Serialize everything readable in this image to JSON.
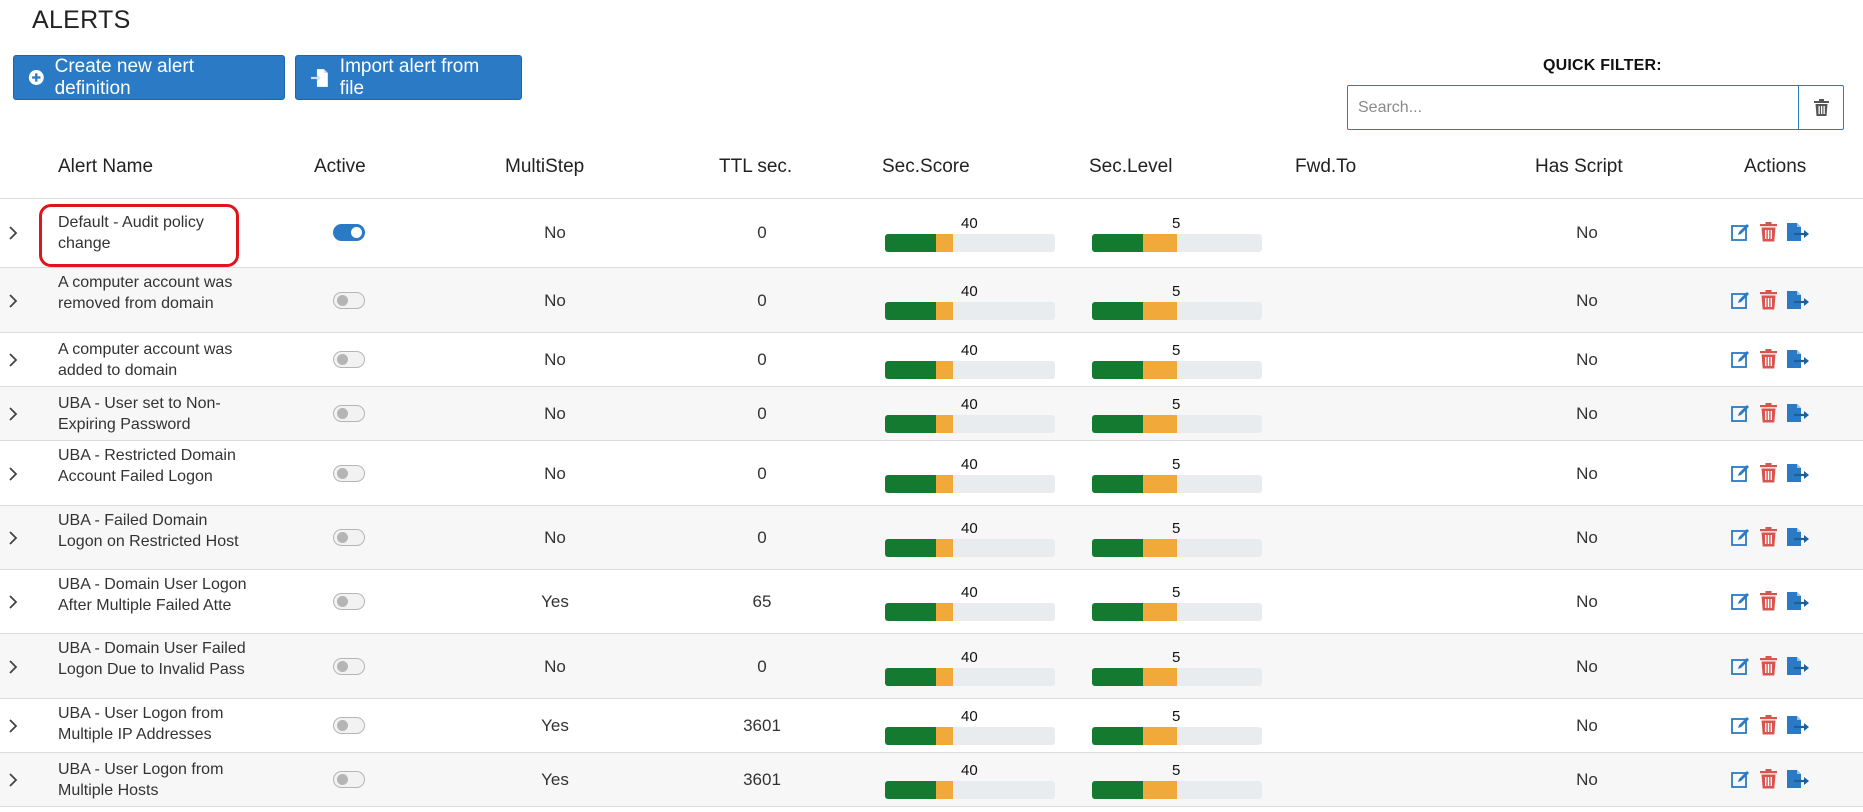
{
  "page": {
    "title": "ALERTS"
  },
  "toolbar": {
    "create_label": "Create new alert definition",
    "import_label": "Import alert from file"
  },
  "quick_filter": {
    "label": "QUICK FILTER:",
    "placeholder": "Search...",
    "value": ""
  },
  "columns": [
    "Alert Name",
    "Active",
    "MultiStep",
    "TTL sec.",
    "Sec.Score",
    "Sec.Level",
    "Fwd.To",
    "Has Script",
    "Actions"
  ],
  "rows": [
    {
      "name": "Default - Audit policy change",
      "active": true,
      "multistep": "No",
      "ttl": "0",
      "sec_score": "40",
      "sec_level": "5",
      "fwd_to": "",
      "has_script": "No"
    },
    {
      "name": "A computer account was removed from domain",
      "active": false,
      "multistep": "No",
      "ttl": "0",
      "sec_score": "40",
      "sec_level": "5",
      "fwd_to": "",
      "has_script": "No"
    },
    {
      "name": "A computer account was added to domain",
      "active": false,
      "multistep": "No",
      "ttl": "0",
      "sec_score": "40",
      "sec_level": "5",
      "fwd_to": "",
      "has_script": "No"
    },
    {
      "name": "UBA - User set to Non-Expiring Password",
      "active": false,
      "multistep": "No",
      "ttl": "0",
      "sec_score": "40",
      "sec_level": "5",
      "fwd_to": "",
      "has_script": "No"
    },
    {
      "name": "UBA - Restricted Domain Account Failed Logon",
      "active": false,
      "multistep": "No",
      "ttl": "0",
      "sec_score": "40",
      "sec_level": "5",
      "fwd_to": "",
      "has_script": "No"
    },
    {
      "name": "UBA - Failed Domain Logon on Restricted Host",
      "active": false,
      "multistep": "No",
      "ttl": "0",
      "sec_score": "40",
      "sec_level": "5",
      "fwd_to": "",
      "has_script": "No"
    },
    {
      "name": "UBA - Domain User Logon After Multiple Failed Atte",
      "active": false,
      "multistep": "Yes",
      "ttl": "65",
      "sec_score": "40",
      "sec_level": "5",
      "fwd_to": "",
      "has_script": "No"
    },
    {
      "name": "UBA - Domain User Failed Logon Due to Invalid Pass",
      "active": false,
      "multistep": "No",
      "ttl": "0",
      "sec_score": "40",
      "sec_level": "5",
      "fwd_to": "",
      "has_script": "No"
    },
    {
      "name": "UBA - User Logon from Multiple IP Addresses",
      "active": false,
      "multistep": "Yes",
      "ttl": "3601",
      "sec_score": "40",
      "sec_level": "5",
      "fwd_to": "",
      "has_script": "No"
    },
    {
      "name": "UBA - User Logon from Multiple Hosts",
      "active": false,
      "multistep": "Yes",
      "ttl": "3601",
      "sec_score": "40",
      "sec_level": "5",
      "fwd_to": "",
      "has_script": "No"
    }
  ],
  "colors": {
    "primary": "#2b7ac5",
    "bar_green": "#137a2f",
    "bar_orange": "#f1aa3a",
    "bar_track": "#e9ecef",
    "delete_red": "#d9534f",
    "highlight": "#e0141a"
  },
  "icons": {
    "create": "plus-circle-icon",
    "import": "file-import-icon",
    "clear": "trash-icon",
    "expand": "chevron-right-icon",
    "edit": "edit-icon",
    "delete": "trash-icon",
    "export": "file-export-icon"
  }
}
